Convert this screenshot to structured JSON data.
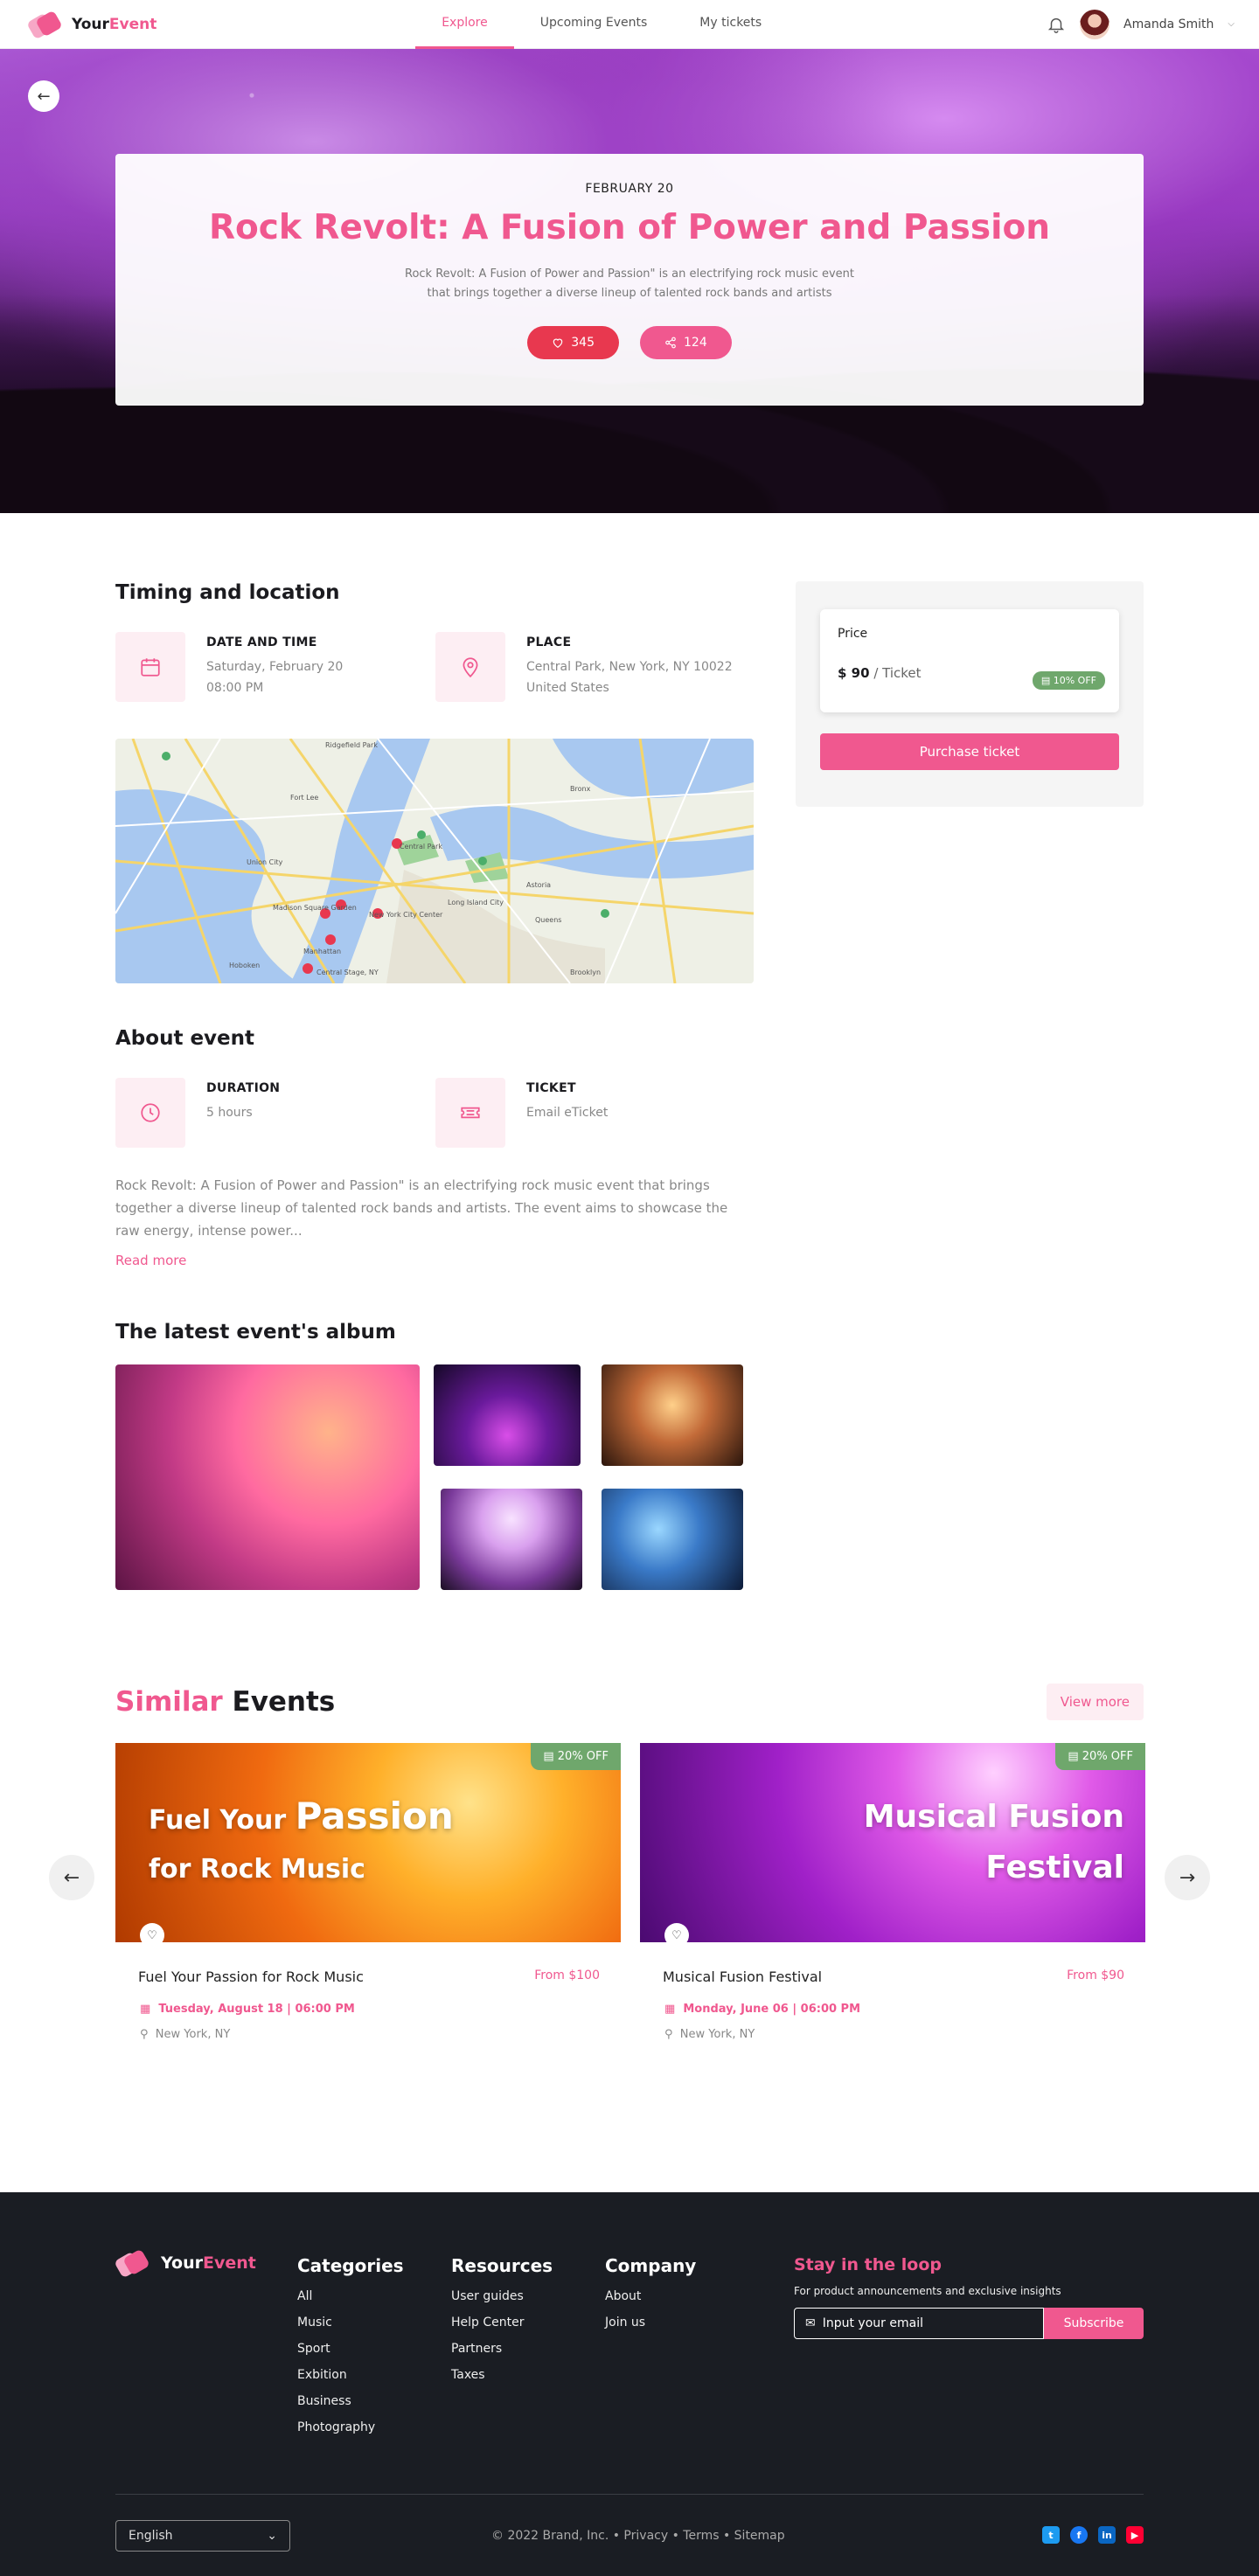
{
  "header": {
    "brand_a": "Your",
    "brand_b": "Event",
    "nav": [
      {
        "label": "Explore",
        "active": true
      },
      {
        "label": "Upcoming Events",
        "active": false
      },
      {
        "label": "My tickets",
        "active": false
      }
    ],
    "user_name": "Amanda Smith"
  },
  "hero": {
    "date": "FEBRUARY 20",
    "title": "Rock Revolt: A Fusion of Power and Passion",
    "description": "Rock Revolt: A Fusion of Power and Passion\" is an electrifying rock music event that brings together a diverse lineup of talented rock bands and artists",
    "likes": "345",
    "shares": "124"
  },
  "timing": {
    "heading": "Timing and location",
    "date_label": "DATE AND TIME",
    "date_line1": "Saturday, February 20",
    "date_line2": "08:00 PM",
    "place_label": "PLACE",
    "place_line1": "Central Park, New York, NY 10022",
    "place_line2": "United States"
  },
  "map": {
    "labels": [
      "Ridgefield Park",
      "Central Park",
      "New York City Center",
      "Madison Square Garden",
      "Manhattan",
      "Queens",
      "Hoboken",
      "Central Stage, NY",
      "Union City",
      "Long Island City",
      "Astoria",
      "Brooklyn",
      "Bronx",
      "Fort Lee"
    ]
  },
  "ticket": {
    "price_label": "Price",
    "price_value": "$ 90",
    "price_unit": " / Ticket",
    "discount": "10% OFF",
    "purchase_label": "Purchase ticket"
  },
  "about": {
    "heading": "About event",
    "duration_label": "DURATION",
    "duration_value": "5 hours",
    "ticket_label": "TICKET",
    "ticket_value": "Email eTicket",
    "description": "Rock Revolt: A Fusion of Power and Passion\" is an electrifying rock music event that brings together a diverse lineup of talented rock bands and artists. The event aims to showcase the raw energy, intense power...",
    "read_more": "Read more"
  },
  "album": {
    "heading": "The latest event's album"
  },
  "similar": {
    "title_a": "Similar",
    "title_b": " Events",
    "view_more": "View more",
    "events": [
      {
        "img_line1a": "Fuel Your ",
        "img_line1b": "Passion",
        "img_line2": "for Rock Music",
        "discount": "20% OFF",
        "title": "Fuel Your Passion for Rock Music",
        "price": "From $100",
        "date": "Tuesday, August 18 | 06:00 PM",
        "location": "New York, NY"
      },
      {
        "img_line1": "Musical Fusion",
        "img_line2": "Festival",
        "discount": "20% OFF",
        "title": "Musical Fusion Festival",
        "price": "From $90",
        "date": "Monday, June 06 | 06:00 PM",
        "location": "New York, NY"
      }
    ]
  },
  "footer": {
    "brand_a": "Your",
    "brand_b": "Event",
    "categories_heading": "Categories",
    "categories": [
      "All",
      "Music",
      "Sport",
      "Exbition",
      "Business",
      "Photography"
    ],
    "resources_heading": "Resources",
    "resources": [
      "User guides",
      "Help Center",
      "Partners",
      "Taxes"
    ],
    "company_heading": "Company",
    "company": [
      "About",
      "Join us"
    ],
    "stay_heading": "Stay in the loop",
    "stay_desc": "For product announcements and exclusive insights",
    "email_placeholder": "Input your email",
    "subscribe_label": "Subscribe",
    "language": "English",
    "copyright": "© 2022 Brand, Inc.  • Privacy • Terms • Sitemap",
    "colors": {
      "twitter": "#1d9bf0",
      "facebook": "#1877f2",
      "linkedin": "#0a66c2",
      "youtube": "#ff0033"
    }
  }
}
